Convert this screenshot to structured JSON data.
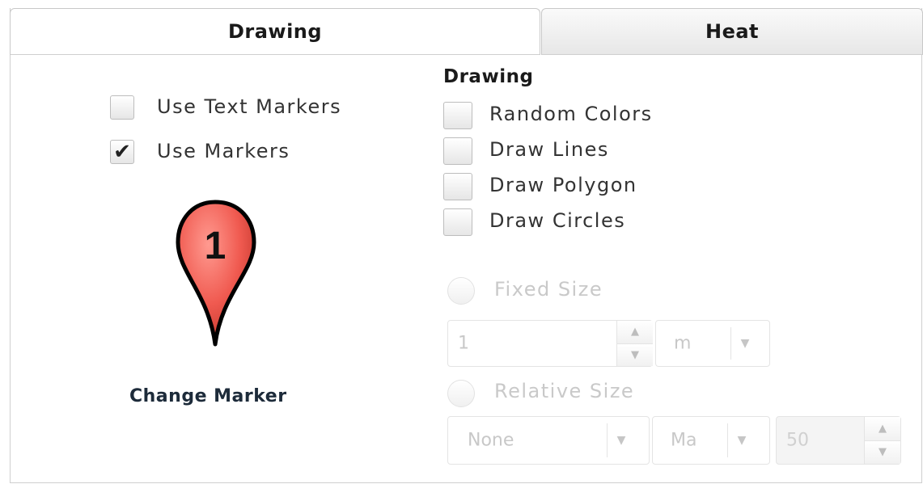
{
  "tabs": [
    {
      "label": "Drawing",
      "active": true
    },
    {
      "label": "Heat",
      "active": false
    }
  ],
  "markers": {
    "use_text_markers": {
      "label": "Use Text Markers",
      "checked": false
    },
    "use_markers": {
      "label": "Use Markers",
      "checked": true
    },
    "marker_preview": {
      "number": "1",
      "color": "#f05a50"
    },
    "change_marker_label": "Change Marker"
  },
  "drawing": {
    "title": "Drawing",
    "options": [
      {
        "label": "Random Colors",
        "checked": false
      },
      {
        "label": "Draw Lines",
        "checked": false
      },
      {
        "label": "Draw Polygon",
        "checked": false
      },
      {
        "label": "Draw Circles",
        "checked": false
      }
    ]
  },
  "size": {
    "fixed_size_label": "Fixed Size",
    "fixed_value": "1",
    "fixed_unit": "m",
    "relative_size_label": "Relative Size",
    "relative_field": "None",
    "relative_agg": "Ma",
    "relative_value": "50"
  },
  "icons": {
    "check": "✔",
    "spin_up": "▲",
    "spin_down": "▼",
    "dropdown": "▼"
  }
}
